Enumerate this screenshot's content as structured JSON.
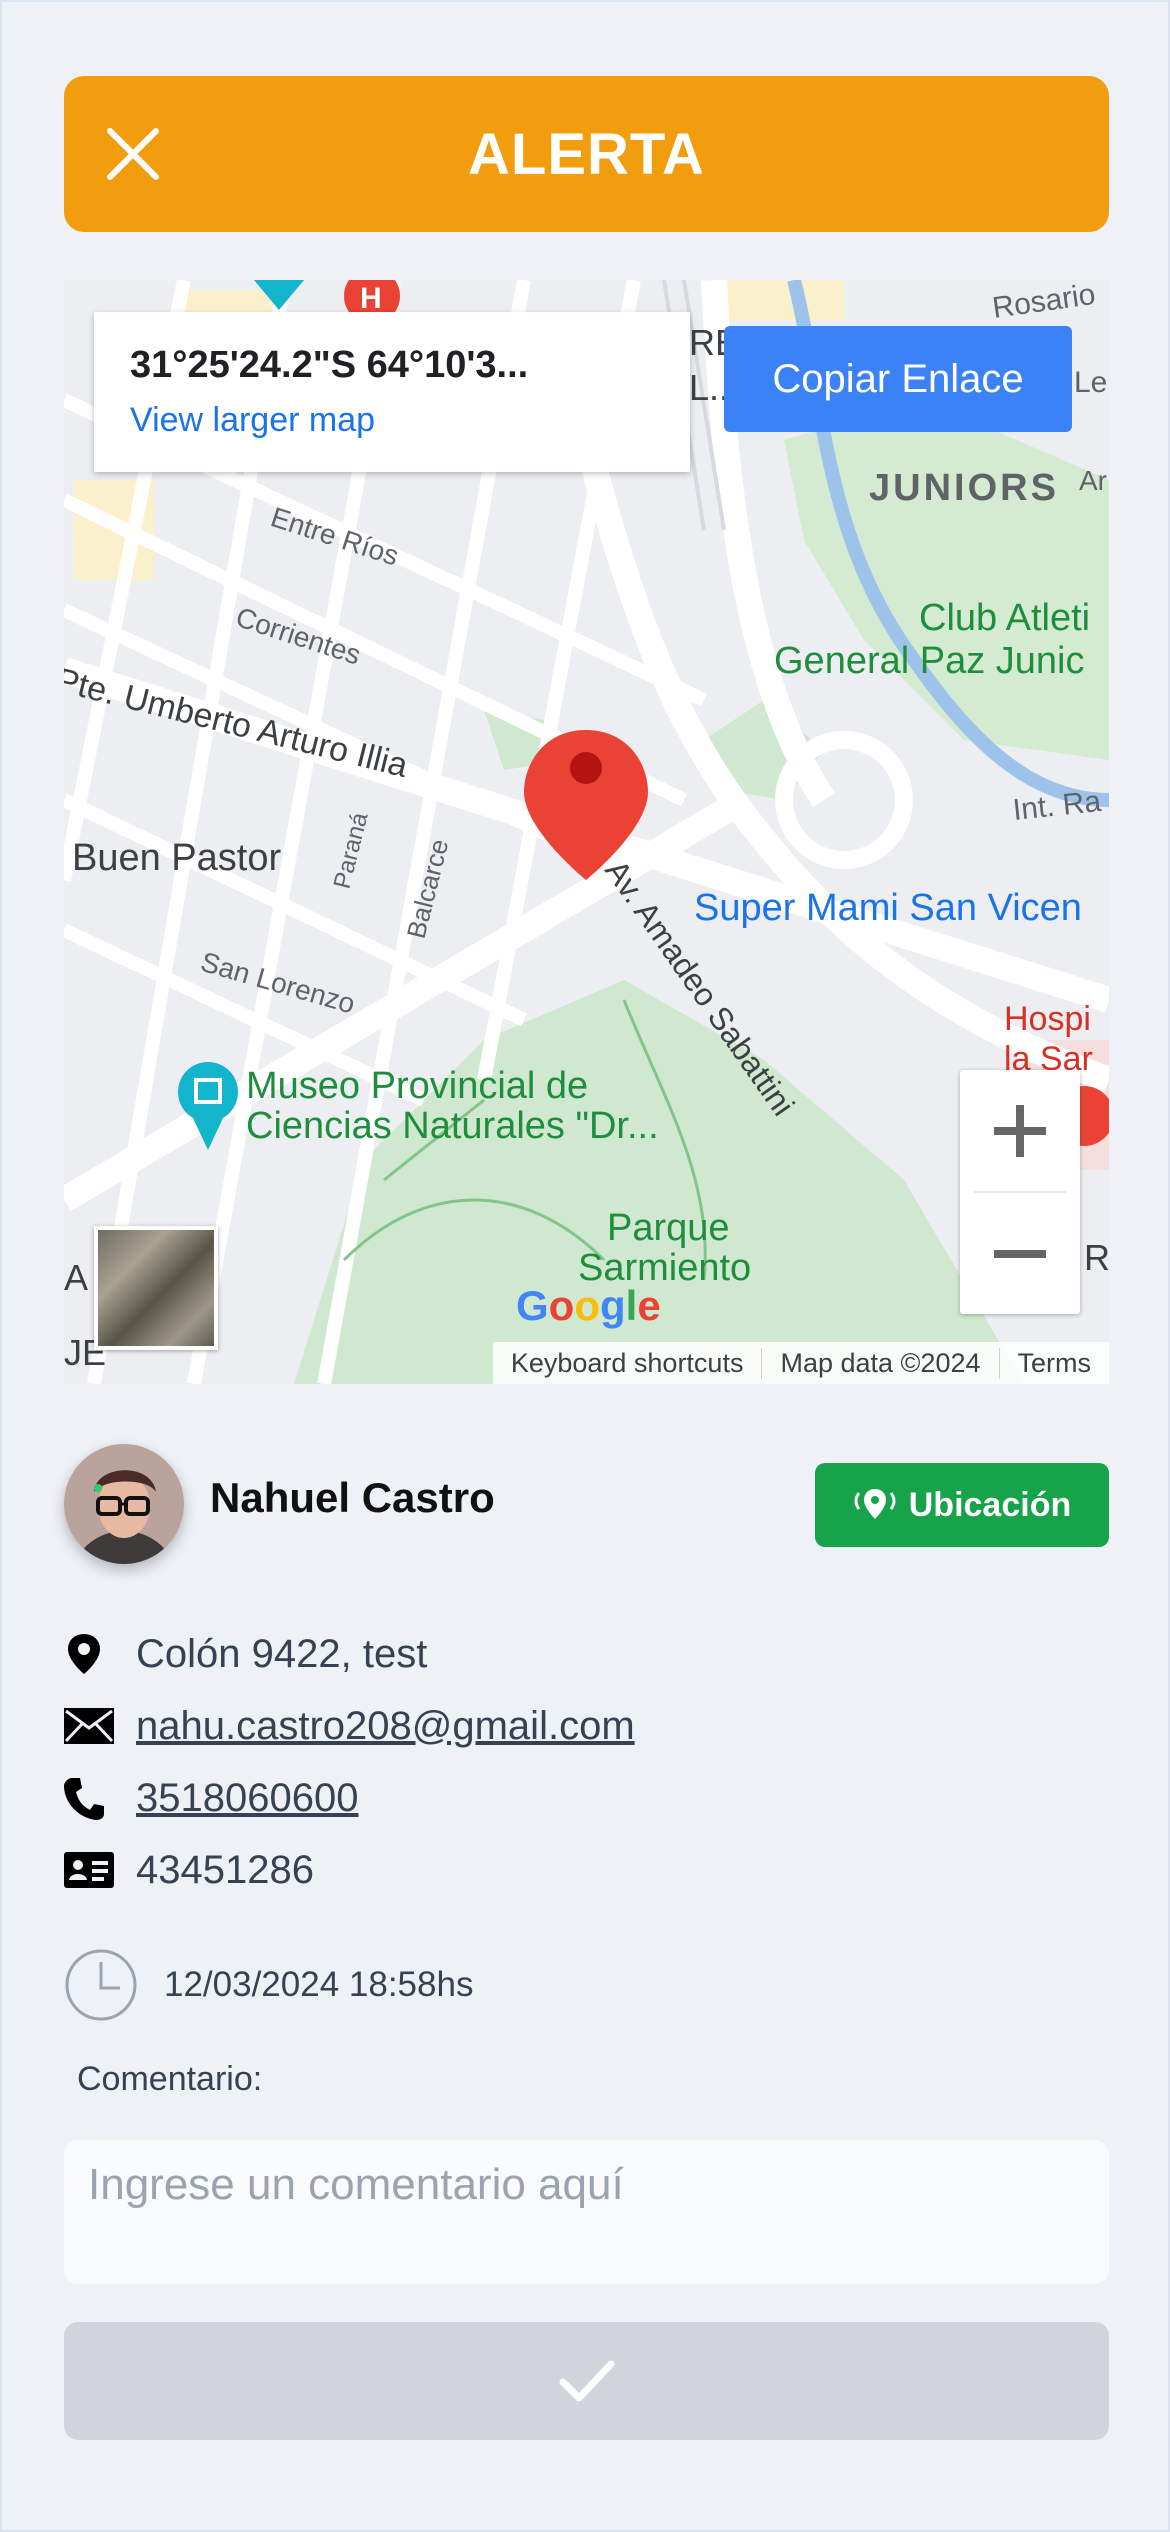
{
  "header": {
    "title": "ALERTA",
    "close_icon": "close-icon",
    "color": "#f29d0d"
  },
  "map": {
    "coordinates": "31°25'24.2\"S 64°10'3...",
    "view_larger_label": "View larger map",
    "copy_link_label": "Copiar Enlace",
    "zoom_in_label": "+",
    "zoom_out_label": "−",
    "google_logo": "Google",
    "footer": {
      "shortcuts": "Keyboard shortcuts",
      "map_data": "Map data ©2024",
      "terms": "Terms"
    },
    "labels": {
      "rosario": "Rosario",
      "juniors": "JUNIORS",
      "club_1": "Club Atleti",
      "club_2": "General Paz Junic",
      "int_ra": "Int. Ra",
      "entre_rios": "Entre Ríos",
      "corrientes": "Corrientes",
      "illia": "Pte. Umberto Arturo Illia",
      "buen_pastor": "Buen Pastor",
      "parana": "Paraná",
      "balcarce": "Balcarce",
      "sabattini": "Av. Amadeo Sabattini",
      "super_mami": "Super Mami San Vicen",
      "san_lorenzo": "San Lorenzo",
      "hosp_1": "Hospi",
      "hosp_2": "la Sar",
      "museo_1": "Museo Provincial de",
      "museo_2": "Ciencias Naturales \"Dr...",
      "parque_1": "Parque",
      "parque_2": "Sarmiento",
      "left_a": "A",
      "left_e": "JE",
      "right_ri": "RI",
      "le": "Le",
      "ar": "Ar",
      "re": "RE",
      "re_dots": "L.."
    }
  },
  "user": {
    "name": "Nahuel Castro",
    "location_button": "Ubicación",
    "address": "Colón 9422, test",
    "email": "nahu.castro208@gmail.com",
    "phone": "3518060600",
    "document_id": "43451286",
    "datetime": "12/03/2024 18:58hs"
  },
  "comment": {
    "label": "Comentario:",
    "placeholder": "Ingrese un comentario aquí",
    "value": ""
  },
  "submit": {
    "icon": "check-icon"
  },
  "colors": {
    "accent": "#f29d0d",
    "copy_button": "#3b82f6",
    "location_button": "#16a34a",
    "submit_disabled": "#d1d5db",
    "pin": "#ea4335"
  }
}
